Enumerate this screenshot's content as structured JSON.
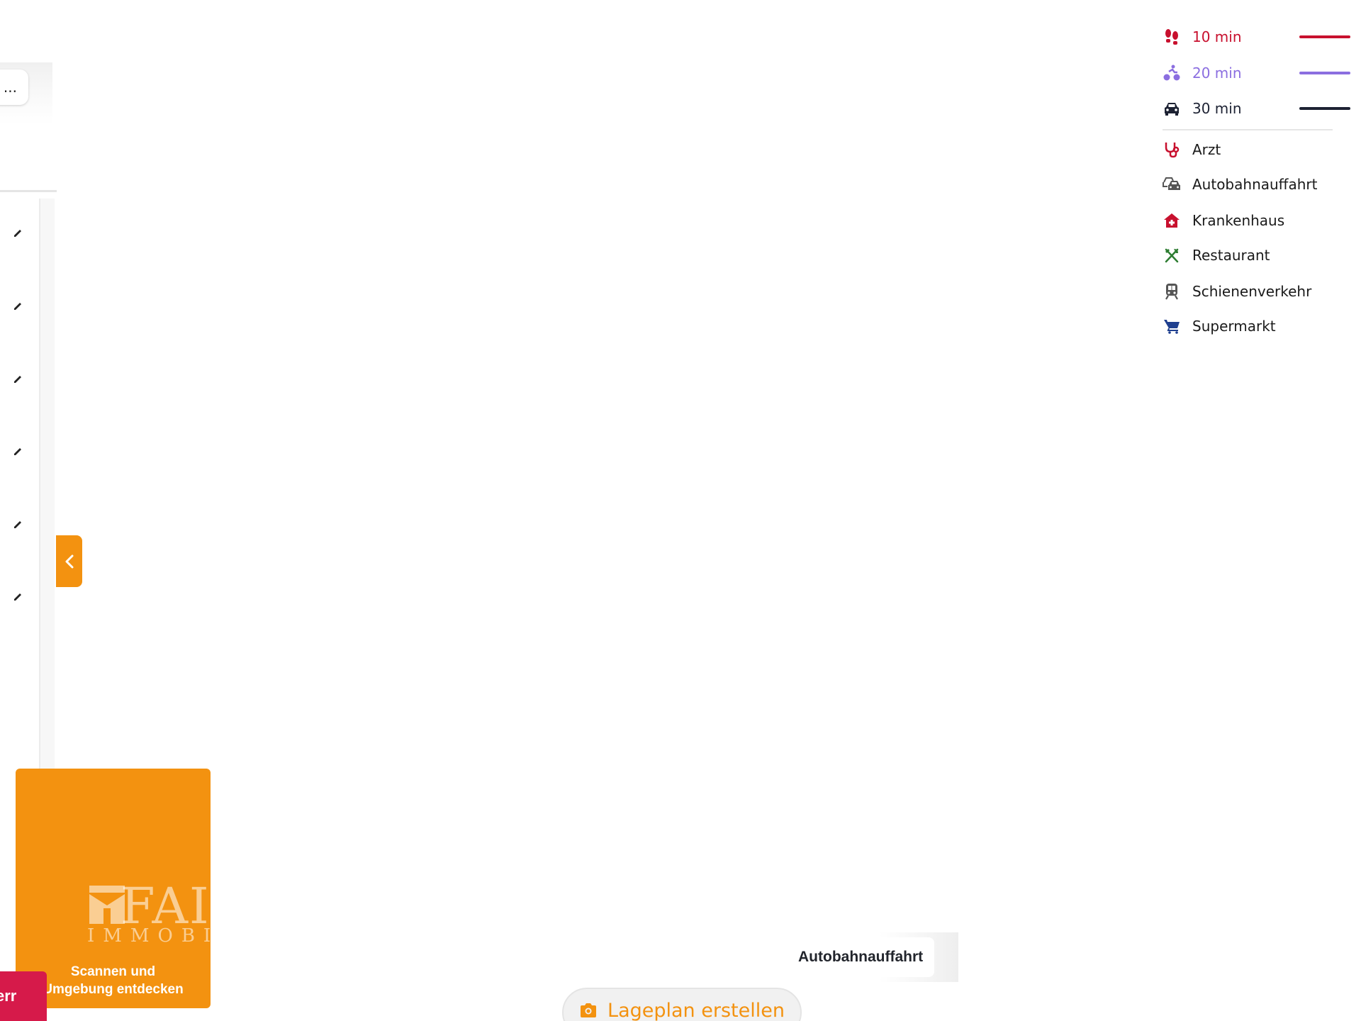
{
  "sidebar": {
    "search_value": "...",
    "red_button_label": "err"
  },
  "promo": {
    "logo_word": "FAI",
    "logo_sub": "IMMOBIL",
    "text_line1": "Scannen und",
    "text_line2": "Umgebung entdecken"
  },
  "legend": {
    "travel_times": [
      {
        "label": "10 min",
        "mode": "walking-icon",
        "color": "#c8102e"
      },
      {
        "label": "20 min",
        "mode": "cycling-icon",
        "color": "#8b6ee0"
      },
      {
        "label": "30 min",
        "mode": "car-icon",
        "color": "#1d2233"
      }
    ],
    "pois": [
      {
        "label": "Arzt",
        "icon": "stethoscope-icon",
        "color": "#c8102e"
      },
      {
        "label": "Autobahnauffahrt",
        "icon": "highway-cars-icon",
        "color": "#555555"
      },
      {
        "label": "Krankenhaus",
        "icon": "hospital-icon",
        "color": "#c8102e"
      },
      {
        "label": "Restaurant",
        "icon": "utensils-icon",
        "color": "#2e7d32"
      },
      {
        "label": "Schienenverkehr",
        "icon": "train-icon",
        "color": "#555555"
      },
      {
        "label": "Supermarkt",
        "icon": "shopping-cart-icon",
        "color": "#1f3f8f"
      }
    ]
  },
  "map": {
    "marker_label": "Autobahnauffahrt"
  },
  "actions": {
    "lageplan_label": "Lageplan erstellen"
  },
  "colors": {
    "accent": "#f39210",
    "brand_red": "#d61a4a"
  }
}
